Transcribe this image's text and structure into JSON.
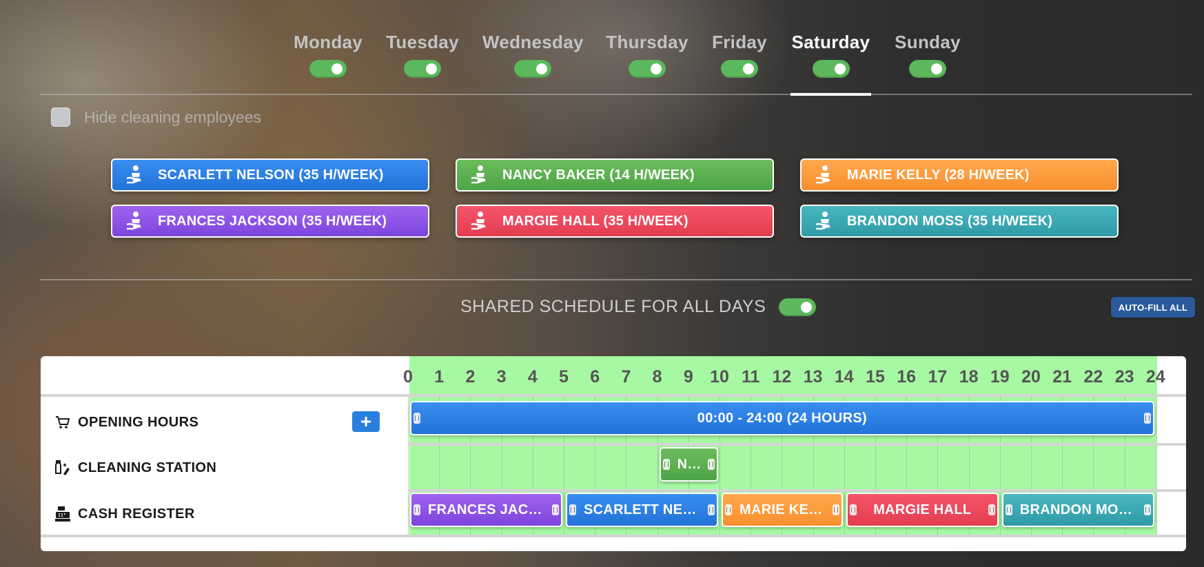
{
  "days": [
    {
      "label": "Monday",
      "enabled": true,
      "active": false
    },
    {
      "label": "Tuesday",
      "enabled": true,
      "active": false
    },
    {
      "label": "Wednesday",
      "enabled": true,
      "active": false
    },
    {
      "label": "Thursday",
      "enabled": true,
      "active": false
    },
    {
      "label": "Friday",
      "enabled": true,
      "active": false
    },
    {
      "label": "Saturday",
      "enabled": true,
      "active": true
    },
    {
      "label": "Sunday",
      "enabled": true,
      "active": false
    }
  ],
  "hide_cleaning": {
    "label": "Hide cleaning employees",
    "checked": false
  },
  "employees": [
    {
      "name": "SCARLETT NELSON (35 H/WEEK)",
      "color": "#2a80e6"
    },
    {
      "name": "NANCY BAKER (14 H/WEEK)",
      "color": "#5aaf50"
    },
    {
      "name": "MARIE KELLY (28 H/WEEK)",
      "color": "#fb9c3c"
    },
    {
      "name": "FRANCES JACKSON (35 H/WEEK)",
      "color": "#8c54e6"
    },
    {
      "name": "MARGIE HALL (35 H/WEEK)",
      "color": "#ec4a5c"
    },
    {
      "name": "BRANDON MOSS (35 H/WEEK)",
      "color": "#3ca8b3"
    }
  ],
  "shared_schedule": {
    "label": "SHARED SCHEDULE FOR ALL DAYS",
    "enabled": true
  },
  "autofill": {
    "label": "AUTO-FILL ALL"
  },
  "hours": [
    "0",
    "1",
    "2",
    "3",
    "4",
    "5",
    "6",
    "7",
    "8",
    "9",
    "10",
    "11",
    "12",
    "13",
    "14",
    "15",
    "16",
    "17",
    "18",
    "19",
    "20",
    "21",
    "22",
    "23",
    "24"
  ],
  "rows": [
    {
      "label": "OPENING HOURS",
      "icon": "cart-icon"
    },
    {
      "label": "CLEANING STATION",
      "icon": "cleaning-icon"
    },
    {
      "label": "CASH REGISTER",
      "icon": "cash-register-icon"
    }
  ],
  "add_button": {
    "label": "+"
  },
  "shifts": {
    "opening": [
      {
        "label": "00:00 - 24:00 (24 HOURS)",
        "start": 0,
        "end": 24,
        "color": "blue"
      }
    ],
    "cleaning": [
      {
        "label": "NA...",
        "start": 8,
        "end": 10,
        "color": "green"
      }
    ],
    "cash": [
      {
        "label": "FRANCES JACKS...",
        "start": 0,
        "end": 5,
        "color": "purple"
      },
      {
        "label": "SCARLETT NELS...",
        "start": 5,
        "end": 10,
        "color": "blue"
      },
      {
        "label": "MARIE KELLY",
        "start": 10,
        "end": 14,
        "color": "orange"
      },
      {
        "label": "MARGIE HALL",
        "start": 14,
        "end": 19,
        "color": "red"
      },
      {
        "label": "BRANDON MOSS",
        "start": 19,
        "end": 24,
        "color": "teal"
      }
    ]
  }
}
